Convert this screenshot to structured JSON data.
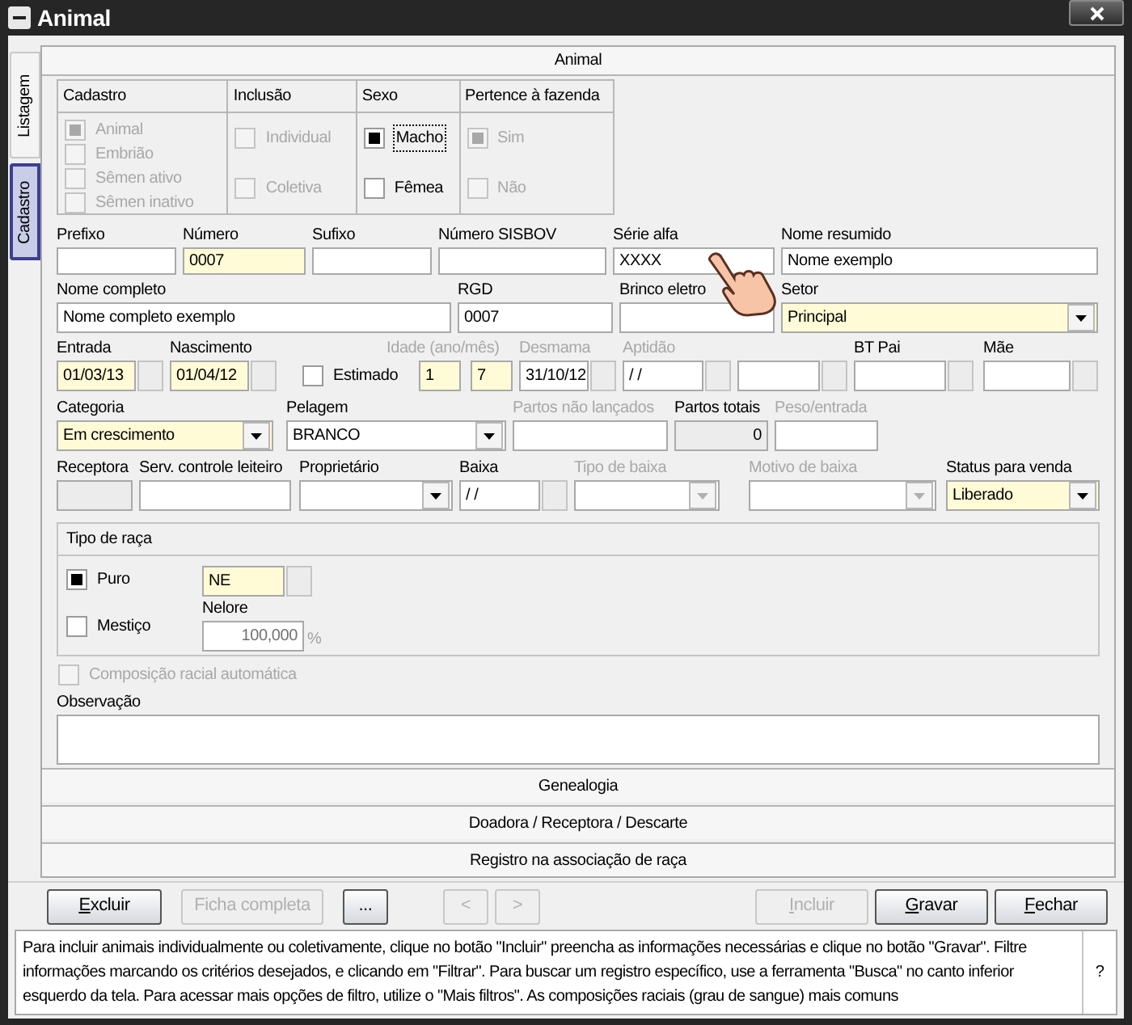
{
  "window": {
    "title": "Animal"
  },
  "side_tabs": [
    {
      "label": "Listagem",
      "selected": false
    },
    {
      "label": "Cadastro",
      "selected": true
    }
  ],
  "panel_title": "Animal",
  "option_groups": [
    {
      "title": "Cadastro",
      "options": [
        {
          "label": "Animal",
          "checked": true,
          "disabled": true
        },
        {
          "label": "Embrião",
          "checked": false,
          "disabled": true
        },
        {
          "label": "Sêmen ativo",
          "checked": false,
          "disabled": true
        },
        {
          "label": "Sêmen inativo",
          "checked": false,
          "disabled": true
        }
      ]
    },
    {
      "title": "Inclusão",
      "options": [
        {
          "label": "Individual",
          "checked": false,
          "disabled": true
        },
        {
          "label": "Coletiva",
          "checked": false,
          "disabled": true
        }
      ]
    },
    {
      "title": "Sexo",
      "options": [
        {
          "label": "Macho",
          "checked": true,
          "disabled": false,
          "focused": true
        },
        {
          "label": "Fêmea",
          "checked": false,
          "disabled": false,
          "focused": false
        }
      ]
    },
    {
      "title": "Pertence à fazenda",
      "options": [
        {
          "label": "Sim",
          "checked": true,
          "disabled": true
        },
        {
          "label": "Não",
          "checked": false,
          "disabled": true
        }
      ]
    }
  ],
  "field_rows": [
    [
      {
        "kind": "text",
        "label": "Prefixo",
        "required": false
      },
      {
        "kind": "text",
        "label": "Número",
        "value": "0007",
        "required": true
      },
      {
        "kind": "text",
        "label": "Sufixo",
        "required": false
      },
      {
        "kind": "text",
        "label": "Número SISBOV",
        "required": false
      },
      {
        "kind": "text",
        "label": "Série alfa",
        "value": "XXXX",
        "required": false
      },
      {
        "kind": "text",
        "label": "Nome resumido",
        "value": "Nome exemplo",
        "required": false
      }
    ],
    [
      {
        "kind": "text",
        "label": "Nome completo",
        "value": "Nome completo exemplo",
        "required": false
      },
      {
        "kind": "text",
        "label": "RGD",
        "value": "0007",
        "required": false
      },
      {
        "kind": "text",
        "label": "Brinco eletro",
        "required": false
      },
      {
        "kind": "combo",
        "label": "Setor",
        "value": "Principal",
        "required": true
      }
    ],
    [
      {
        "kind": "lookup",
        "label": "Entrada",
        "value": "01/03/13",
        "required": true
      },
      {
        "kind": "lookup",
        "label": "Nascimento",
        "value": "01/04/12",
        "required": true
      },
      {
        "kind": "checkbox",
        "label": "Estimado",
        "checked": false
      },
      {
        "kind": "pair",
        "label": "Idade (ano/mês)",
        "values": [
          "1",
          "7"
        ],
        "required": true,
        "disabled": true
      },
      {
        "kind": "lookup",
        "label": "Desmama",
        "value": "31/10/12",
        "required": false,
        "disabled": true
      },
      {
        "kind": "lookup",
        "label": "Aptidão",
        "value": "/ /",
        "required": false,
        "disabled": true
      },
      {
        "kind": "lookup",
        "required": false
      },
      {
        "kind": "lookup",
        "label": "BT Pai",
        "required": false
      },
      {
        "kind": "lookup",
        "label": "Mãe",
        "required": false
      }
    ],
    [
      {
        "kind": "combo",
        "label": "Categoria",
        "value": "Em crescimento",
        "required": true
      },
      {
        "kind": "combo",
        "label": "Pelagem",
        "value": "BRANCO",
        "required": false
      },
      {
        "kind": "text",
        "label": "Partos não lançados",
        "required": false,
        "disabled": true
      },
      {
        "kind": "readonly",
        "label": "Partos totais",
        "value": "0"
      },
      {
        "kind": "text",
        "label": "Peso/entrada",
        "required": false,
        "disabled": true
      }
    ],
    [
      {
        "kind": "readonly",
        "label": "Receptora"
      },
      {
        "kind": "text",
        "label": "Serv. controle leiteiro",
        "required": false
      },
      {
        "kind": "combo",
        "label": "Proprietário",
        "required": false
      },
      {
        "kind": "lookup",
        "label": "Baixa",
        "value": "/ /",
        "required": false
      },
      {
        "kind": "combo",
        "label": "Tipo de baixa",
        "required": false,
        "disabled": true
      },
      {
        "kind": "combo",
        "label": "Motivo de baixa",
        "required": false,
        "disabled": true
      },
      {
        "kind": "combo",
        "label": "Status para venda",
        "value": "Liberado",
        "required": true
      }
    ]
  ],
  "breed": {
    "title": "Tipo de raça",
    "options": [
      {
        "label": "Puro",
        "checked": true
      },
      {
        "label": "Mestiço",
        "checked": false
      }
    ],
    "breed_code": "NE",
    "breed_name": "Nelore",
    "percent": "100,000",
    "percent_sign": "%"
  },
  "auto_composition": {
    "label": "Composição racial automática",
    "checked": false,
    "disabled": true
  },
  "notes": {
    "label": "Observação"
  },
  "sections": [
    "Genealogia",
    "Doadora / Receptora / Descarte",
    "Registro na associação de raça"
  ],
  "left_buttons": [
    {
      "label": "Excluir",
      "first_letter_underlined": true,
      "disabled": false
    },
    {
      "label": "Ficha completa",
      "disabled": true
    },
    {
      "label": "...",
      "disabled": false
    }
  ],
  "nav_buttons": [
    {
      "label": "<",
      "disabled": true
    },
    {
      "label": ">",
      "disabled": true
    }
  ],
  "right_buttons": [
    {
      "label": "Incluir",
      "first_letter_underlined": true,
      "disabled": true
    },
    {
      "label": "Gravar",
      "first_letter_underlined": true,
      "disabled": false
    },
    {
      "label": "Fechar",
      "first_letter_underlined": true,
      "disabled": false
    }
  ],
  "help": {
    "text": "Para incluir animais individualmente ou coletivamente, clique no botão \"Incluir\" preencha as informações necessárias e clique no botão \"Gravar\". Filtre informações marcando os critérios desejados, e clicando em \"Filtrar\". Para buscar um registro específico, use a ferramenta \"Busca\" no canto inferior esquerdo da tela. Para acessar mais opções de filtro, utilize o \"Mais filtros\". As composições raciais (grau de sangue) mais comuns",
    "button": "?"
  }
}
